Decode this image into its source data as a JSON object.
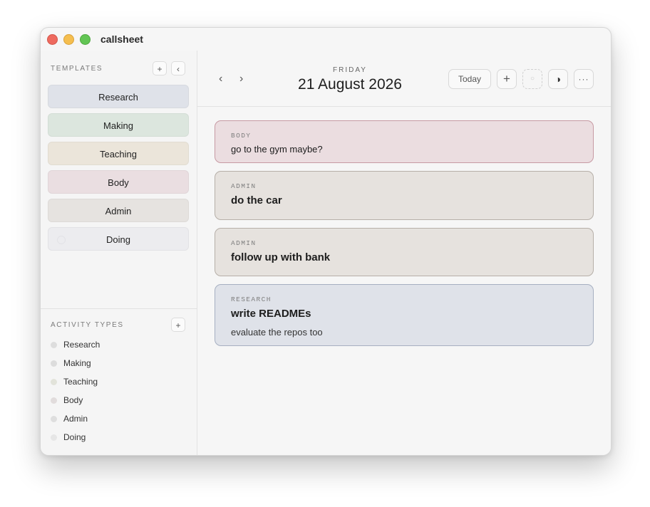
{
  "app": {
    "title": "callsheet"
  },
  "sidebar": {
    "templates_label": "TEMPLATES",
    "add_button": "+",
    "collapse_button": "‹",
    "templates": [
      {
        "label": "Research",
        "color": "#dfe2e9"
      },
      {
        "label": "Making",
        "color": "#dce6de"
      },
      {
        "label": "Teaching",
        "color": "#ebe5da"
      },
      {
        "label": "Body",
        "color": "#eadee1"
      },
      {
        "label": "Admin",
        "color": "#e6e3e0"
      },
      {
        "label": "Doing",
        "color": "#ececef"
      }
    ],
    "activity_label": "ACTIVITY TYPES",
    "activity_add_button": "+",
    "activities": [
      {
        "label": "Research",
        "color": "#dddddd"
      },
      {
        "label": "Making",
        "color": "#dcdcdc"
      },
      {
        "label": "Teaching",
        "color": "#e2e3da"
      },
      {
        "label": "Body",
        "color": "#e1dcdc"
      },
      {
        "label": "Admin",
        "color": "#dedede"
      },
      {
        "label": "Doing",
        "color": "#e6e6e6"
      }
    ]
  },
  "header": {
    "weekday": "FRIDAY",
    "date": "21 August 2026",
    "prev": "‹",
    "next": "›",
    "today_button": "Today",
    "add_button": "+",
    "dashed_button_icon": "○",
    "contrast_icon": "◑",
    "more_icon": "···"
  },
  "entries": [
    {
      "category": "BODY",
      "title": "go to the gym maybe?",
      "note": "",
      "bg": "#ebdde0",
      "border": "#c79aa3"
    },
    {
      "category": "ADMIN",
      "title": "do the car",
      "note": "",
      "bg": "#e6e2de",
      "border": "#b6afa8"
    },
    {
      "category": "ADMIN",
      "title": "follow up with bank",
      "note": "",
      "bg": "#e6e2de",
      "border": "#b6afa8"
    },
    {
      "category": "RESEARCH",
      "title": "write READMEs",
      "note": "evaluate the repos too",
      "bg": "#dfe2e9",
      "border": "#a6afc1"
    }
  ]
}
